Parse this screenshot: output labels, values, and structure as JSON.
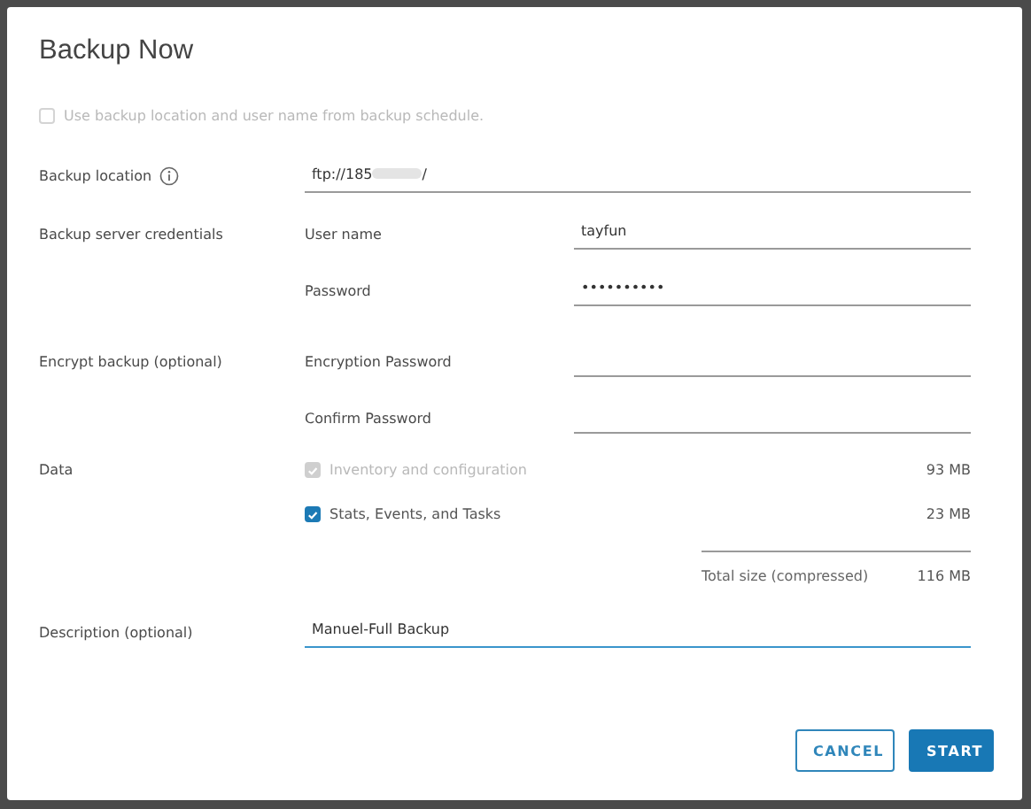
{
  "dialog": {
    "title": "Backup Now",
    "use_schedule": {
      "label": "Use backup location and user name from backup schedule.",
      "checked": false,
      "disabled": true
    },
    "backup_location": {
      "label": "Backup location",
      "value_start": "ftp://185",
      "value_end": "/"
    },
    "credentials": {
      "label": "Backup server credentials",
      "fields": [
        {
          "label": "User name",
          "value": "tayfun"
        },
        {
          "label": "Password",
          "value": "••••••••••"
        }
      ]
    },
    "encrypt": {
      "label": "Encrypt backup (optional)",
      "fields": [
        {
          "label": "Encryption Password"
        },
        {
          "label": "Confirm Password"
        }
      ]
    },
    "data": {
      "label": "Data",
      "items": [
        {
          "label": "Inventory and configuration",
          "size": "93 MB",
          "checked": true,
          "disabled": true
        },
        {
          "label": "Stats, Events, and Tasks",
          "size": "23 MB",
          "checked": true,
          "disabled": false
        }
      ],
      "total_label": "Total size (compressed)",
      "total": "116 MB"
    },
    "description": {
      "label": "Description (optional)",
      "value": "Manuel-Full Backup",
      "focused": true
    },
    "buttons": [
      {
        "label": "CANCEL",
        "kind": "secondary"
      },
      {
        "label": "START",
        "kind": "primary"
      }
    ]
  }
}
